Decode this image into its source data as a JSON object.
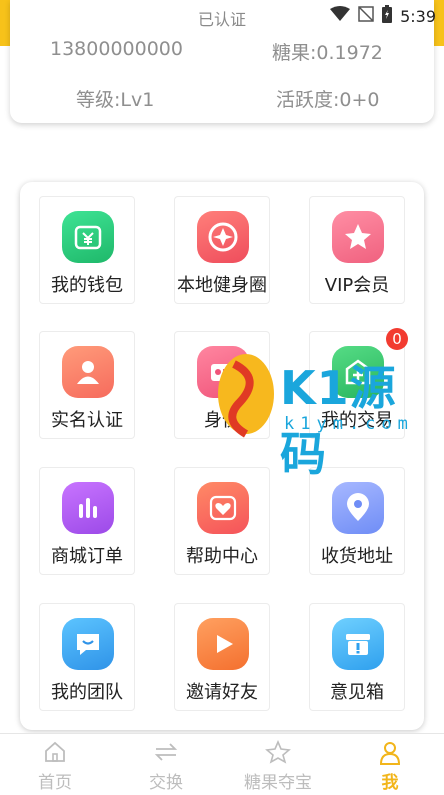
{
  "colors": {
    "accent_yellow": "#f7c21a",
    "badge_red": "#f23b30",
    "watermark_blue": "#1aa6dc"
  },
  "status_bar": {
    "verified_label": "已认证",
    "time": "5:39",
    "icons": [
      "wifi-icon",
      "no-signal-icon",
      "battery-icon"
    ]
  },
  "profile": {
    "phone": "13800000000",
    "candy_label": "糖果:0.1972",
    "level_label": "等级:Lv1",
    "activity_label": "活跃度:0+0"
  },
  "menu": {
    "items": [
      {
        "label": "我的钱包",
        "icon": "wallet-icon",
        "color": "#2ecf7e"
      },
      {
        "label": "本地健身圈",
        "icon": "fitness-circle-icon",
        "color": "#f5606a"
      },
      {
        "label": "VIP会员",
        "icon": "vip-star-icon",
        "color": "#f7788c"
      },
      {
        "label": "实名认证",
        "icon": "real-name-icon",
        "color": "#f8826a"
      },
      {
        "label": "身份",
        "icon": "identity-icon",
        "color": "#f56a82"
      },
      {
        "label": "我的交易",
        "icon": "trade-icon",
        "color": "#3cc96a",
        "badge": "0"
      },
      {
        "label": "商城订单",
        "icon": "order-icon",
        "color": "#b15cf2"
      },
      {
        "label": "帮助中心",
        "icon": "help-heart-icon",
        "color": "#fa6b5e"
      },
      {
        "label": "收货地址",
        "icon": "location-icon",
        "color": "#8aa2fb"
      },
      {
        "label": "我的团队",
        "icon": "team-chat-icon",
        "color": "#41a9f3"
      },
      {
        "label": "邀请好友",
        "icon": "invite-play-icon",
        "color": "#fb8040"
      },
      {
        "label": "意见箱",
        "icon": "suggestion-box-icon",
        "color": "#3fb1f4"
      }
    ]
  },
  "watermark": {
    "brand": "K1源码",
    "domain": "k1ym.com"
  },
  "bottom_nav": {
    "items": [
      {
        "label": "首页",
        "icon": "home-icon"
      },
      {
        "label": "交换",
        "icon": "exchange-icon"
      },
      {
        "label": "糖果夺宝",
        "icon": "star-icon"
      },
      {
        "label": "我",
        "icon": "profile-icon",
        "active": true
      }
    ]
  }
}
